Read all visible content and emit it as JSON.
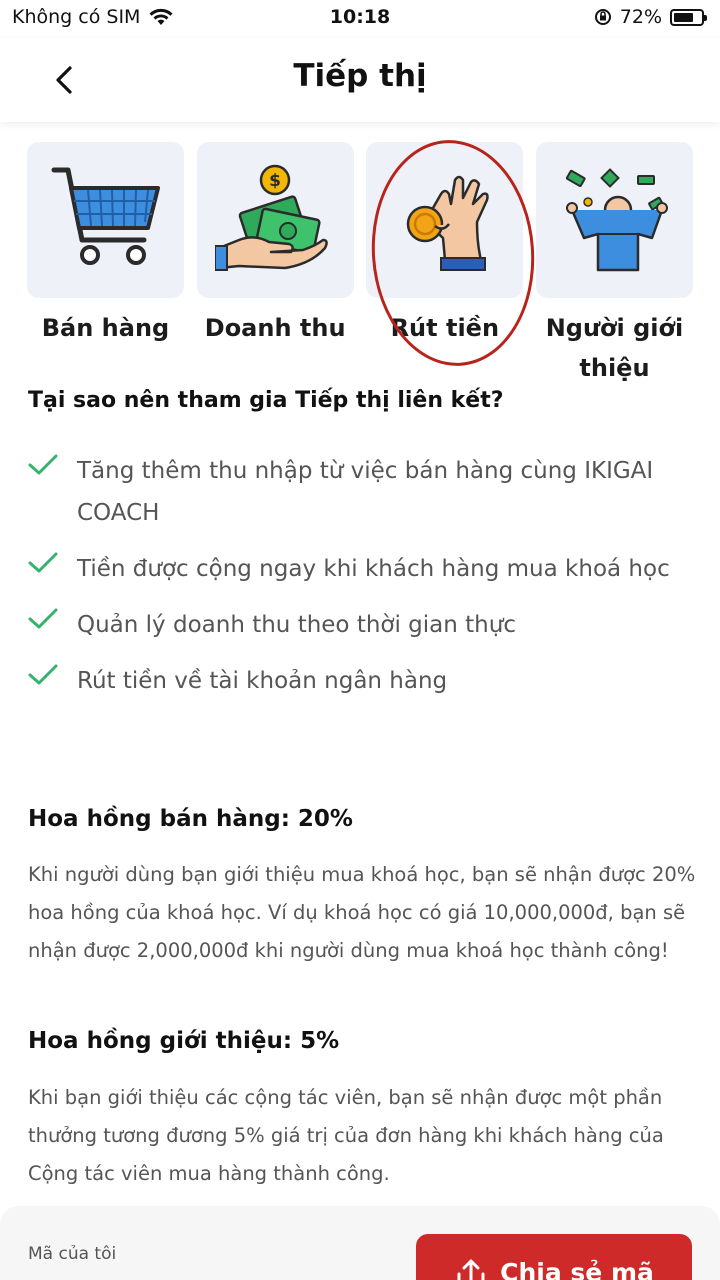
{
  "status_bar": {
    "carrier": "Không có SIM",
    "time": "10:18",
    "battery": "72%",
    "battery_level": 0.72
  },
  "header": {
    "title": "Tiếp thị"
  },
  "tiles": [
    {
      "label": "Bán hàng",
      "icon": "shopping-cart-icon"
    },
    {
      "label": "Doanh thu",
      "icon": "money-hand-icon"
    },
    {
      "label": "Rút tiền",
      "icon": "coin-pinch-icon"
    },
    {
      "label": "Người giới thiệu",
      "icon": "celebrating-person-icon"
    }
  ],
  "why": {
    "title": "Tại sao nên tham gia Tiếp thị liên kết?",
    "benefits": [
      "Tăng thêm thu nhập từ việc bán hàng cùng IKIGAI COACH",
      "Tiền được cộng ngay khi khách hàng mua khoá học",
      "Quản lý doanh thu theo thời gian thực",
      "Rút tiền về tài khoản ngân hàng"
    ]
  },
  "sales_commission": {
    "title": "Hoa hồng bán hàng: 20%",
    "text": "Khi người dùng bạn giới thiệu mua khoá học, bạn sẽ nhận được 20% hoa hồng của khoá học. Ví dụ khoá học có giá 10,000,000đ, bạn sẽ nhận được 2,000,000đ khi người dùng mua khoá học thành công!"
  },
  "referral_commission": {
    "title": "Hoa hồng giới thiệu: 5%",
    "text": "Khi bạn giới thiệu các cộng tác viên, bạn sẽ nhận được một phần thưởng tương đương 5% giá trị của đơn hàng khi khách hàng của Cộng tác viên mua hàng thành công."
  },
  "bottom": {
    "code_label": "Mã của tôi",
    "share_label": "Chia sẻ mã"
  },
  "colors": {
    "accent": "#cf2a2a",
    "check": "#34b36b",
    "tile_bg": "#eef1f8",
    "highlight_ring": "#b8241c"
  }
}
